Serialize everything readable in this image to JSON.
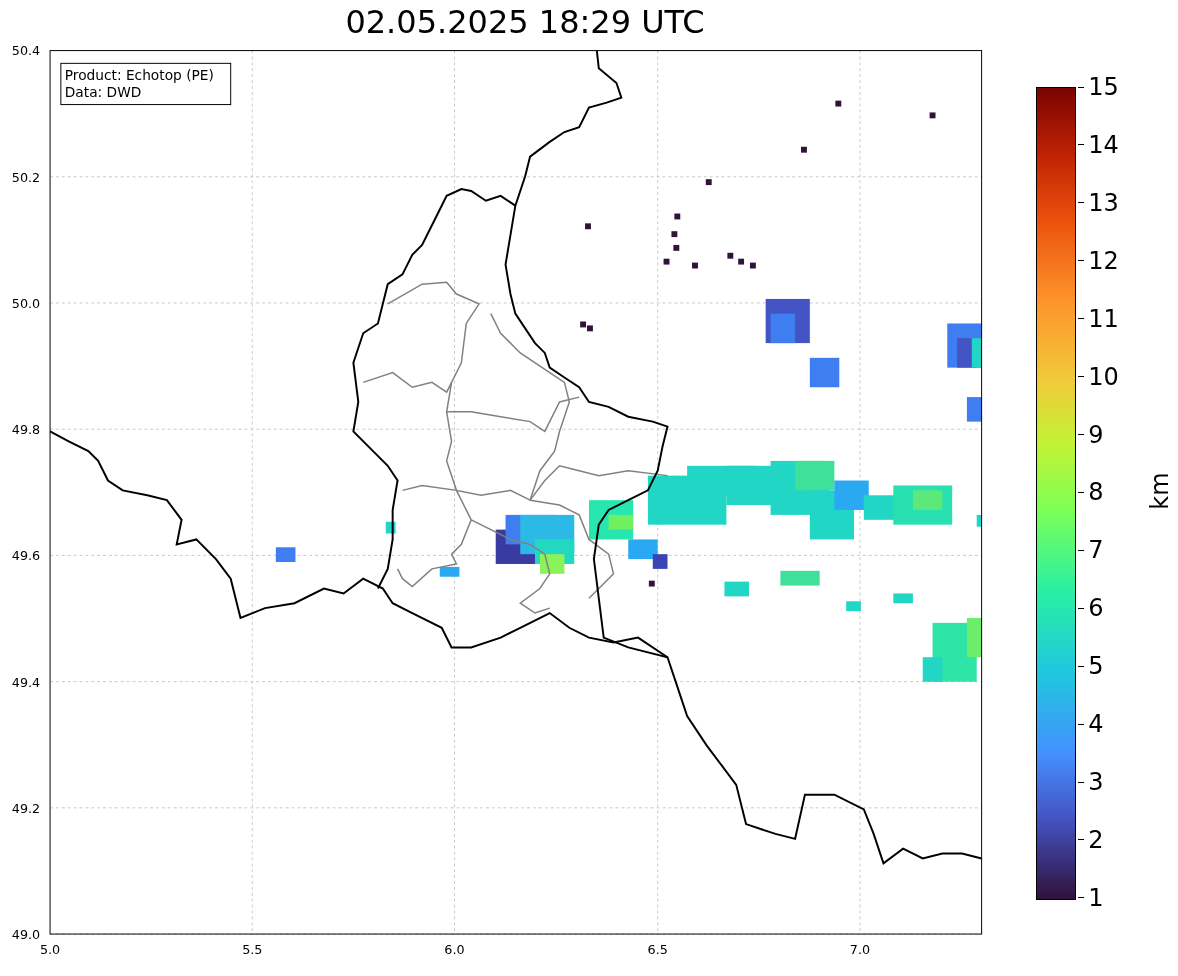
{
  "title": "02.05.2025 18:29 UTC",
  "info_box": [
    "Product: Echotop (PE)",
    "Data: DWD"
  ],
  "x_ticks": [
    "5.0",
    "5.5",
    "6.0",
    "6.5",
    "7.0"
  ],
  "y_ticks": [
    "50.4",
    "50.2",
    "50.0",
    "49.8",
    "49.6",
    "49.4",
    "49.2",
    "49.0"
  ],
  "colorbar": {
    "label": "km",
    "ticks": [
      "15",
      "14",
      "13",
      "12",
      "11",
      "10",
      "9",
      "8",
      "7",
      "6",
      "5",
      "4",
      "3",
      "2",
      "1"
    ]
  }
}
